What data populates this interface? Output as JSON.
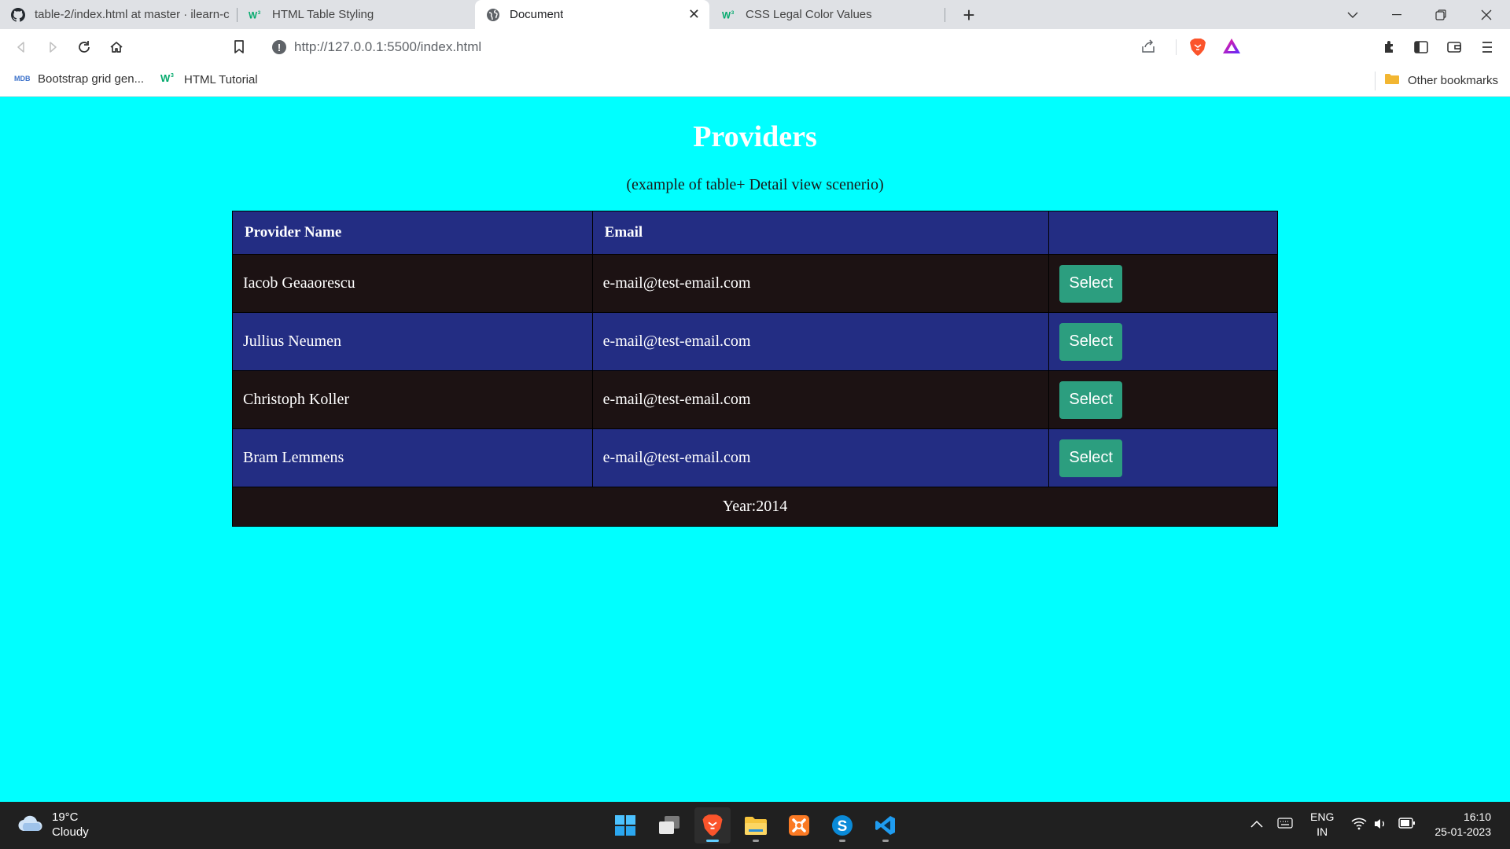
{
  "browser": {
    "tabs": [
      {
        "title": "table-2/index.html at master · ilearn-c",
        "icon": "github-icon"
      },
      {
        "title": "HTML Table Styling",
        "icon": "w3schools-icon"
      },
      {
        "title": "Document",
        "icon": "globe-icon",
        "active": true
      },
      {
        "title": "CSS Legal Color Values",
        "icon": "w3schools-icon"
      }
    ],
    "url": "http://127.0.0.1:5500/index.html",
    "bookmarks": [
      {
        "label": "Bootstrap grid gen...",
        "icon": "mdb-icon"
      },
      {
        "label": "HTML Tutorial",
        "icon": "w3schools-icon"
      }
    ],
    "other_bookmarks": "Other bookmarks"
  },
  "page": {
    "title": "Providers",
    "subtitle": "(example of table+ Detail view scenerio)",
    "table": {
      "headers": [
        "Provider Name",
        "Email",
        ""
      ],
      "rows": [
        {
          "name": "Iacob Geaaorescu",
          "email": "e-mail@test-email.com",
          "action": "Select"
        },
        {
          "name": "Jullius Neumen",
          "email": "e-mail@test-email.com",
          "action": "Select"
        },
        {
          "name": "Christoph Koller",
          "email": "e-mail@test-email.com",
          "action": "Select"
        },
        {
          "name": "Bram Lemmens",
          "email": "e-mail@test-email.com",
          "action": "Select"
        }
      ],
      "footer": "Year:2014"
    },
    "colors": {
      "background": "#00ffff",
      "header_row": "#232d83",
      "dark_row": "#1c1213",
      "button": "#2c9e7f"
    }
  },
  "taskbar": {
    "weather": {
      "temp": "19°C",
      "condition": "Cloudy"
    },
    "language": {
      "line1": "ENG",
      "line2": "IN"
    },
    "clock": {
      "time": "16:10",
      "date": "25-01-2023"
    }
  }
}
